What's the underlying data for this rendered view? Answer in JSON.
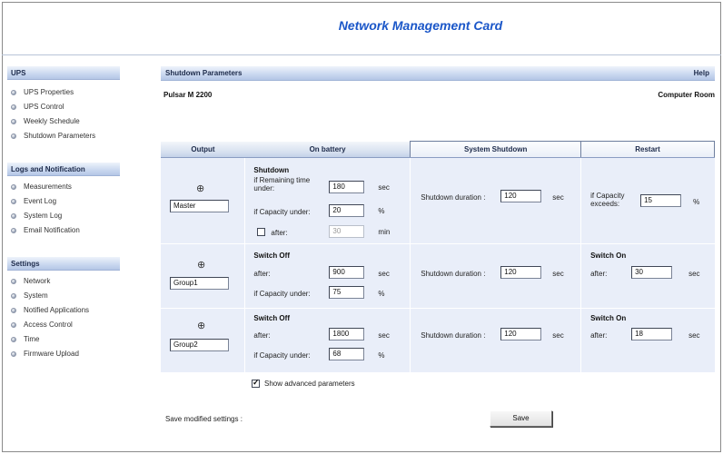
{
  "header": {
    "title": "Network Management Card"
  },
  "sidebar": {
    "sections": [
      {
        "title": "UPS",
        "items": [
          "UPS Properties",
          "UPS Control",
          "Weekly Schedule",
          "Shutdown Parameters"
        ]
      },
      {
        "title": "Logs and Notification",
        "items": [
          "Measurements",
          "Event Log",
          "System Log",
          "Email Notification"
        ]
      },
      {
        "title": "Settings",
        "items": [
          "Network",
          "System",
          "Notified Applications",
          "Access Control",
          "Time",
          "Firmware Upload"
        ]
      }
    ]
  },
  "main": {
    "title": "Shutdown Parameters",
    "help": "Help",
    "model": "Pulsar M 2200",
    "location": "Computer Room",
    "columns": [
      "Output",
      "On battery",
      "System Shutdown",
      "Restart"
    ],
    "rows": [
      {
        "output": "Master",
        "battery": {
          "heading": "Shutdown",
          "remaining_label": "if Remaining time under:",
          "remaining_value": "180",
          "remaining_unit": "sec",
          "capacity_label": "if Capacity under:",
          "capacity_value": "20",
          "capacity_unit": "%",
          "after_label": "after:",
          "after_value": "30",
          "after_unit": "min",
          "after_checked": false
        },
        "shutdown": {
          "label": "Shutdown duration :",
          "value": "120",
          "unit": "sec"
        },
        "restart": {
          "label": "if Capacity exceeds:",
          "value": "15",
          "unit": "%"
        }
      },
      {
        "output": "Group1",
        "battery": {
          "heading": "Switch Off",
          "after_label": "after:",
          "after_value": "900",
          "after_unit": "sec",
          "capacity_label": "if Capacity under:",
          "capacity_value": "75",
          "capacity_unit": "%"
        },
        "shutdown": {
          "label": "Shutdown duration :",
          "value": "120",
          "unit": "sec"
        },
        "restart": {
          "heading": "Switch On",
          "label": "after:",
          "value": "30",
          "unit": "sec"
        }
      },
      {
        "output": "Group2",
        "battery": {
          "heading": "Switch Off",
          "after_label": "after:",
          "after_value": "1800",
          "after_unit": "sec",
          "capacity_label": "if Capacity under:",
          "capacity_value": "68",
          "capacity_unit": "%"
        },
        "shutdown": {
          "label": "Shutdown duration :",
          "value": "120",
          "unit": "sec"
        },
        "restart": {
          "heading": "Switch On",
          "label": "after:",
          "value": "18",
          "unit": "sec"
        }
      }
    ],
    "advanced_label": "Show advanced parameters",
    "advanced_checked": true,
    "save_label": "Save modified settings :",
    "save_button": "Save"
  },
  "icons": {
    "output": "power-plug-icon",
    "bullet": "bullet-icon"
  },
  "colors": {
    "title": "#1a56c8",
    "section_band": "#c9d7ef",
    "row_bg": "#e9eef9"
  }
}
